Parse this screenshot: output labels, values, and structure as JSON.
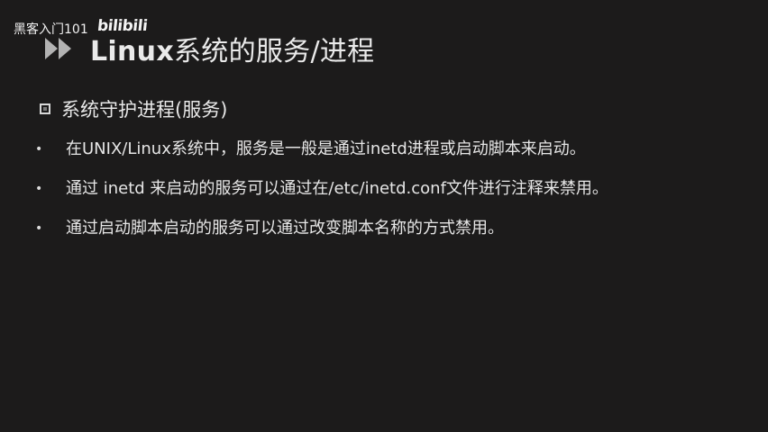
{
  "watermark": {
    "text": "黑客入门101",
    "logo_text": "bilibili"
  },
  "title": {
    "main": "Linux",
    "sub": "系统的服务/进程"
  },
  "section": {
    "heading": "系统守护进程(服务)"
  },
  "bullets": [
    {
      "text": "在UNIX/Linux系统中，服务是一般是通过inetd进程或启动脚本来启动。"
    },
    {
      "text": "通过 inetd 来启动的服务可以通过在/etc/inetd.conf文件进行注释来禁用。"
    },
    {
      "text": "通过启动脚本启动的服务可以通过改变脚本名称的方式禁用。"
    }
  ],
  "icons": {
    "title_arrow": "double-chevron-icon",
    "section_bullet": "square-bullet-icon",
    "item_bullet": "dot-icon"
  },
  "colors": {
    "background": "#1c1b1b",
    "text": "#e6e6e6",
    "arrow": "#b5b5b5"
  }
}
